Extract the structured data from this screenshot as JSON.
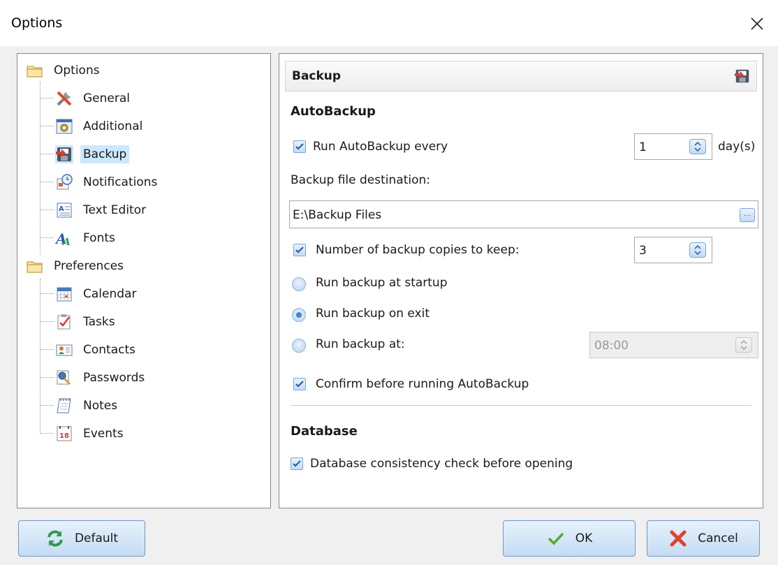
{
  "window": {
    "title": "Options"
  },
  "tree": {
    "groups": [
      {
        "label": "Options",
        "icon": "folder-icon",
        "items": [
          {
            "label": "General",
            "icon": "tools-icon"
          },
          {
            "label": "Additional",
            "icon": "settings-window-icon"
          },
          {
            "label": "Backup",
            "icon": "backup-icon",
            "selected": true
          },
          {
            "label": "Notifications",
            "icon": "notification-clock-icon"
          },
          {
            "label": "Text Editor",
            "icon": "text-editor-icon"
          },
          {
            "label": "Fonts",
            "icon": "fonts-icon"
          }
        ]
      },
      {
        "label": "Preferences",
        "icon": "folder-icon",
        "items": [
          {
            "label": "Calendar",
            "icon": "calendar-icon"
          },
          {
            "label": "Tasks",
            "icon": "tasks-icon"
          },
          {
            "label": "Contacts",
            "icon": "contacts-icon"
          },
          {
            "label": "Passwords",
            "icon": "passwords-icon"
          },
          {
            "label": "Notes",
            "icon": "notes-icon"
          },
          {
            "label": "Events",
            "icon": "events-icon"
          }
        ]
      }
    ]
  },
  "panel": {
    "header": "Backup",
    "autobackup": {
      "title": "AutoBackup",
      "run_every_label": "Run AutoBackup every",
      "run_every_checked": true,
      "run_every_value": "1",
      "run_every_unit": "day(s)",
      "destination_label": "Backup file destination:",
      "destination_value": "E:\\Backup Files",
      "browse_label": "...",
      "copies_label": "Number of backup copies to keep:",
      "copies_checked": true,
      "copies_value": "3",
      "radio_startup_label": "Run backup at startup",
      "radio_exit_label": "Run backup on exit",
      "radio_at_label": "Run backup at:",
      "selected_radio": "exit",
      "time_value": "08:00",
      "confirm_label": "Confirm before running AutoBackup",
      "confirm_checked": true
    },
    "database": {
      "title": "Database",
      "consistency_label": "Database consistency check before opening",
      "consistency_checked": true
    }
  },
  "buttons": {
    "default_label": "Default",
    "ok_label": "OK",
    "cancel_label": "Cancel"
  },
  "colors": {
    "accent_blue": "#3b86d6",
    "selection": "#cce8ff",
    "button_border": "#6e97c7"
  }
}
